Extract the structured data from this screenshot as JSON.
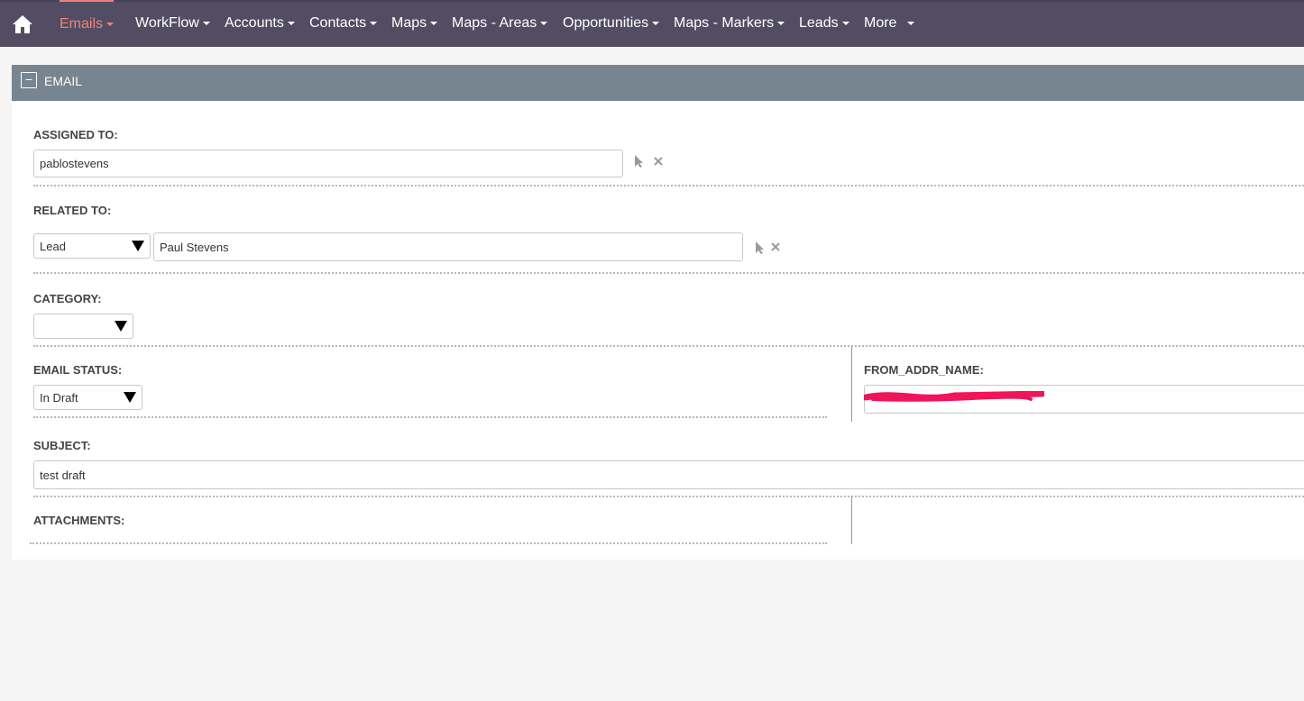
{
  "nav": {
    "items": [
      {
        "label": "Emails",
        "active": true
      },
      {
        "label": "WorkFlow"
      },
      {
        "label": "Accounts"
      },
      {
        "label": "Contacts"
      },
      {
        "label": "Maps"
      },
      {
        "label": "Maps - Areas"
      },
      {
        "label": "Opportunities"
      },
      {
        "label": "Maps - Markers"
      },
      {
        "label": "Leads"
      },
      {
        "label": "More"
      }
    ],
    "icons": {
      "home": "home-icon"
    }
  },
  "panel": {
    "collapse_symbol": "−",
    "title": "EMAIL"
  },
  "fields": {
    "assigned_to": {
      "label": "ASSIGNED TO:",
      "value": "pablostevens"
    },
    "related_to": {
      "label": "RELATED TO:",
      "type_value": "Lead",
      "value": "Paul Stevens"
    },
    "category": {
      "label": "CATEGORY:",
      "value": ""
    },
    "email_status": {
      "label": "EMAIL STATUS:",
      "value": "In Draft"
    },
    "from_addr_name": {
      "label": "FROM_ADDR_NAME:",
      "value": "",
      "redacted": true
    },
    "subject": {
      "label": "SUBJECT:",
      "value": "test draft"
    },
    "attachments": {
      "label": "ATTACHMENTS:"
    }
  },
  "colors": {
    "nav_bg": "#534d64",
    "nav_active": "#f08377",
    "panel_header": "#778591",
    "redaction": "#f0145a"
  }
}
